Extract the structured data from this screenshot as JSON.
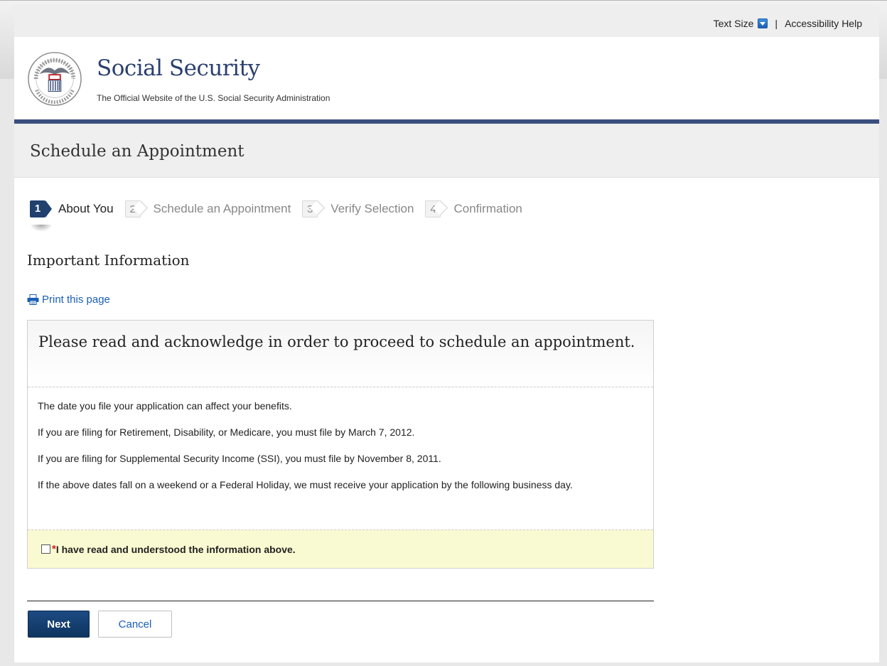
{
  "utility_bar": {
    "text_size_label": "Text Size",
    "separator": "|",
    "accessibility_help": "Accessibility Help"
  },
  "header": {
    "logo_icon": "ssa-seal-icon",
    "title": "Social Security",
    "subtitle": "The Official Website of the U.S. Social Security Administration"
  },
  "page_title": "Schedule an Appointment",
  "steps": [
    {
      "number": "1",
      "label": "About You",
      "state": "active"
    },
    {
      "number": "2",
      "label": "Schedule an Appointment",
      "state": "inactive"
    },
    {
      "number": "3",
      "label": "Verify Selection",
      "state": "inactive"
    },
    {
      "number": "4",
      "label": "Confirmation",
      "state": "inactive"
    }
  ],
  "section_heading": "Important Information",
  "print_link": {
    "label": "Print this page",
    "icon": "printer-icon"
  },
  "notice": {
    "heading": "Please read and acknowledge in order to proceed to schedule an appointment.",
    "paragraphs": [
      "The date you file your application can affect your benefits.",
      "If you are filing for Retirement, Disability, or Medicare, you must file by March 7, 2012.",
      "If you are filing for Supplemental Security Income (SSI), you must file by November 8, 2011.",
      "If the above dates fall on a weekend or a Federal Holiday, we must receive your application by the following business day."
    ],
    "acknowledge": {
      "required_marker": "*",
      "label": "I have read and understood the information above.",
      "checked": false
    }
  },
  "buttons": {
    "next": "Next",
    "cancel": "Cancel"
  },
  "colors": {
    "brand_navy": "#2a3f6f",
    "header_bar": "#3a4f7d",
    "link_blue": "#1a5fb4",
    "ack_background": "#fafad2",
    "required_red": "#d42020"
  }
}
